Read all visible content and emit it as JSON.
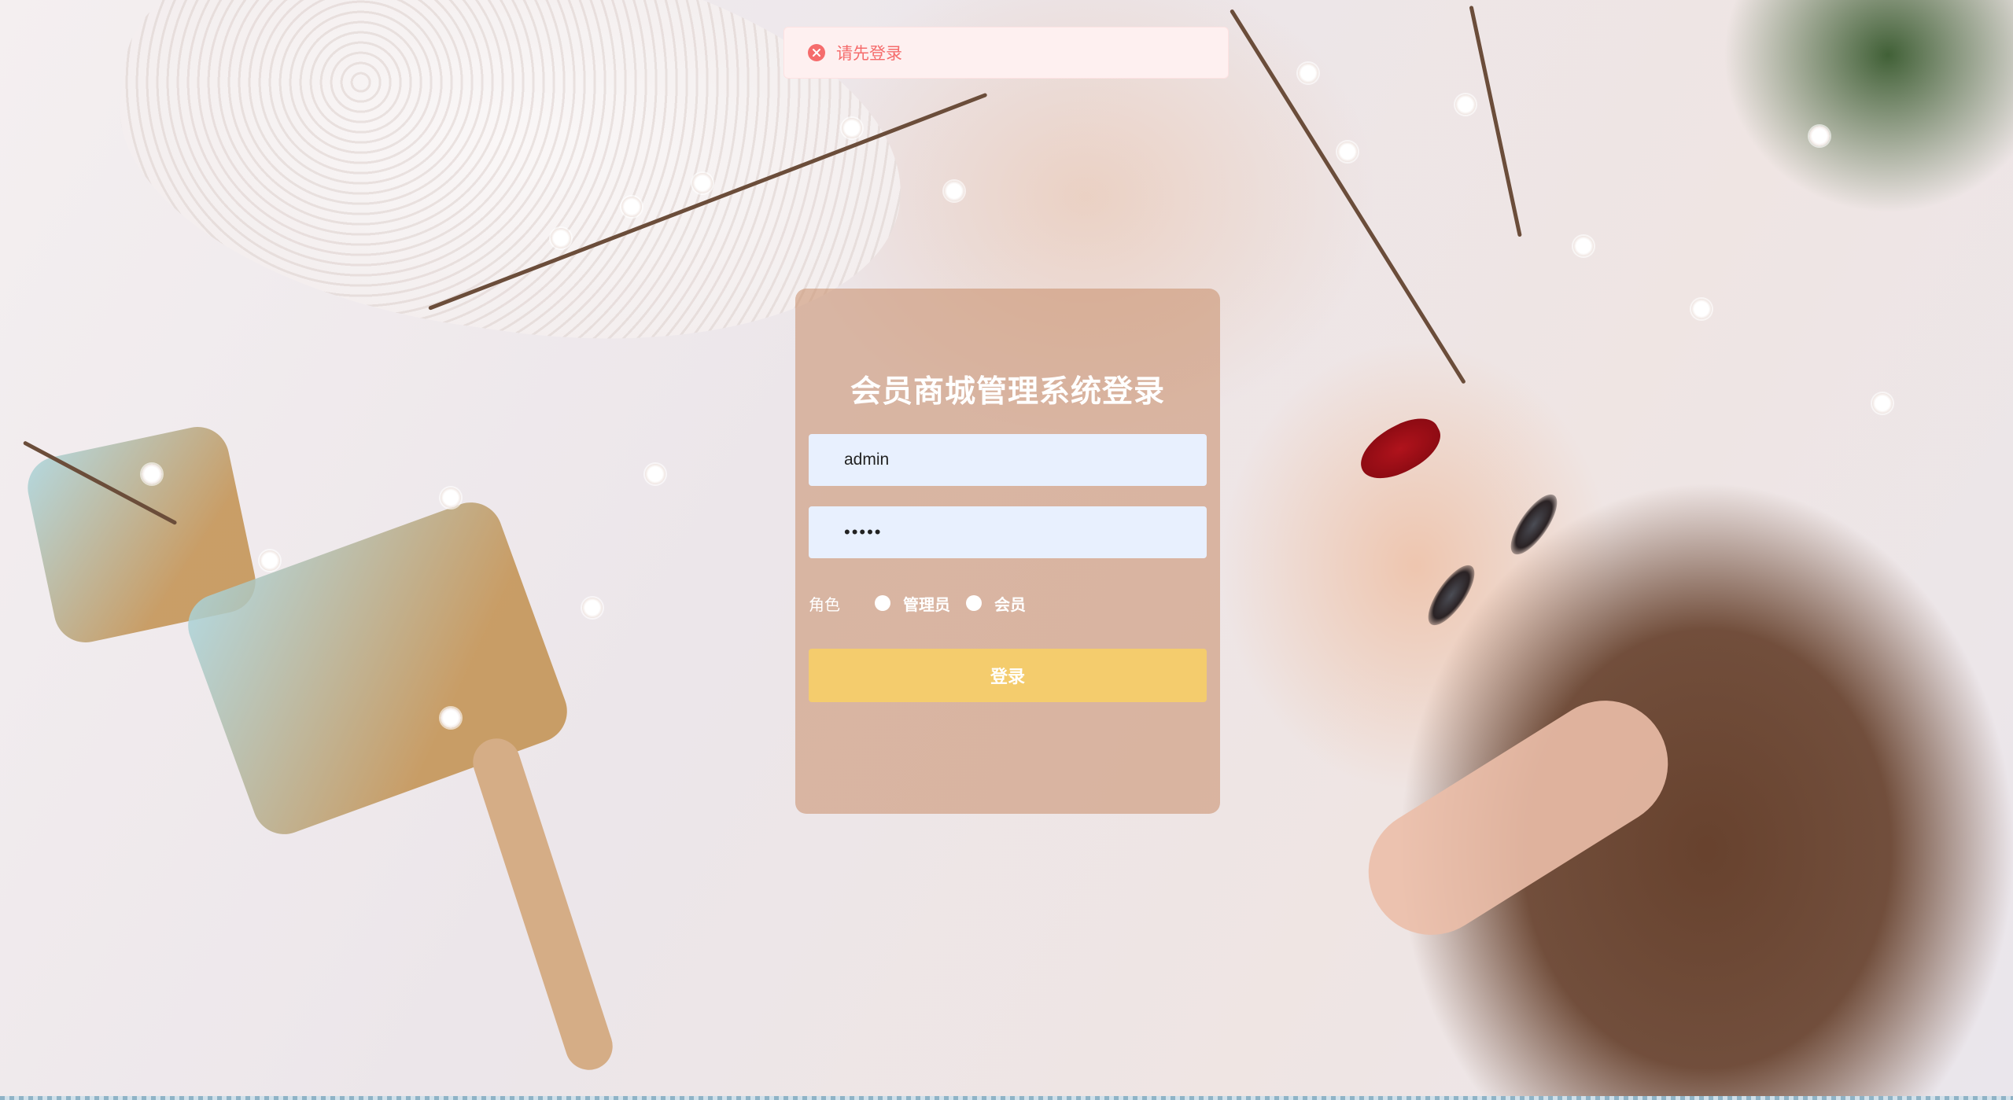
{
  "toast": {
    "message": "请先登录",
    "icon": "close-circle-icon",
    "color": "#f56c6c"
  },
  "login": {
    "title": "会员商城管理系统登录",
    "username_value": "admin",
    "password_value": "•••••",
    "role_label": "角色",
    "roles": [
      {
        "label": "管理员"
      },
      {
        "label": "会员"
      }
    ],
    "submit_label": "登录",
    "button_color": "#f6ce68"
  }
}
